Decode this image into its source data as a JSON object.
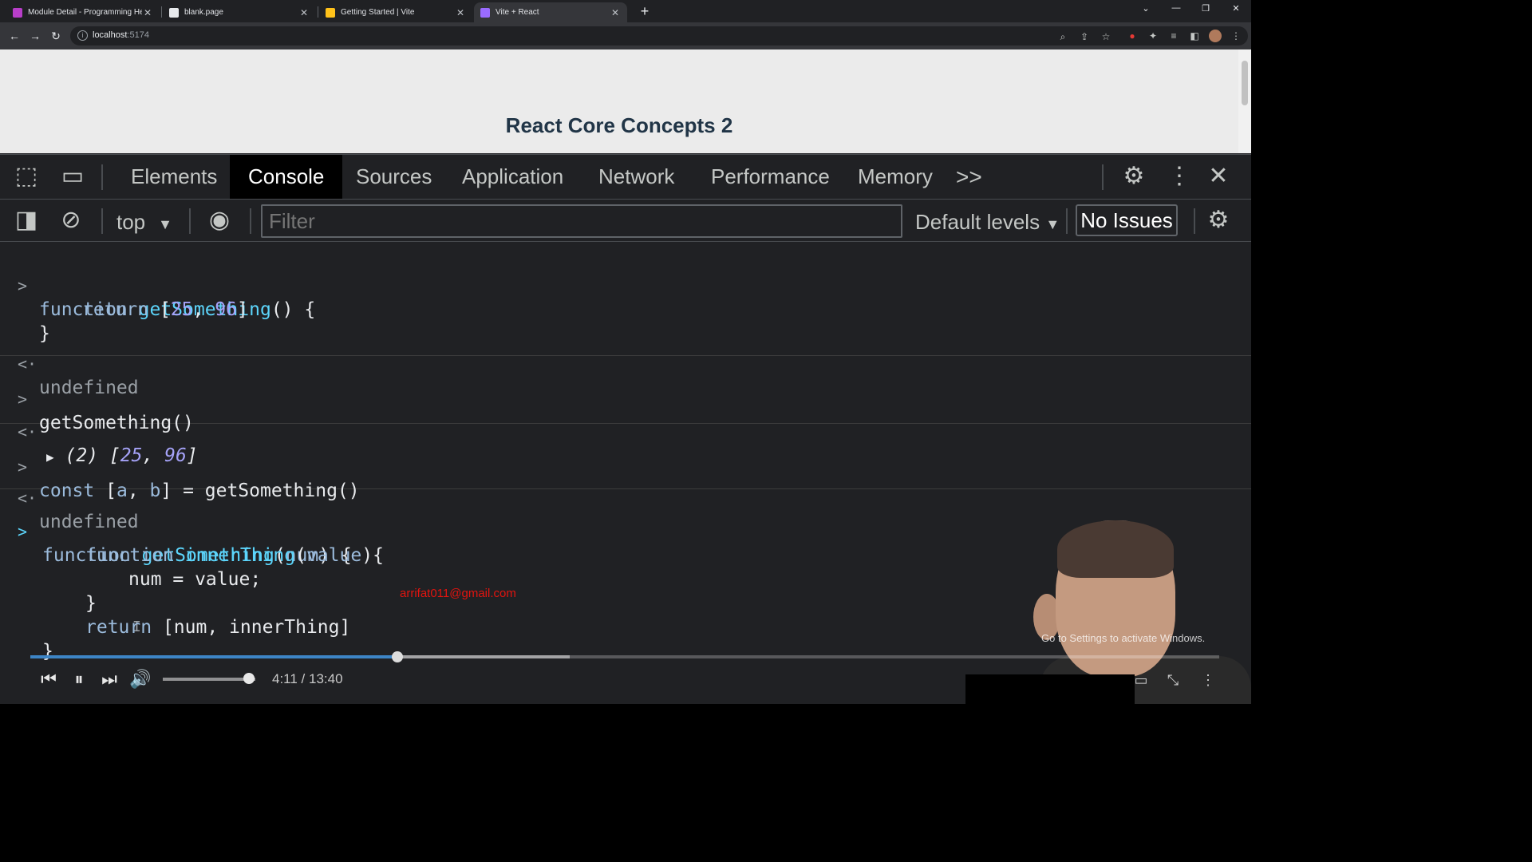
{
  "tabs": [
    {
      "title": "Module Detail - Programming Hero",
      "favicon_color": "#b83ec9"
    },
    {
      "title": "blank.page",
      "favicon_color": "#e8eaed"
    },
    {
      "title": "Getting Started | Vite",
      "favicon_color": "#ffc21a"
    },
    {
      "title": "Vite + React",
      "favicon_color": "#9a6bff",
      "active": true
    }
  ],
  "omnibox": {
    "host": "localhost",
    "port": ":5174"
  },
  "page": {
    "heading": "React Core Concepts 2"
  },
  "devtools": {
    "tabs": [
      "Elements",
      "Console",
      "Sources",
      "Application",
      "Network",
      "Performance",
      "Memory"
    ],
    "active_tab": "Console",
    "more": ">>",
    "console_bar": {
      "context": "top",
      "filter_placeholder": "Filter",
      "levels": "Default levels",
      "issues": "No Issues"
    }
  },
  "console": {
    "e1": {
      "l1a": "function",
      "l1b": "getSomething",
      "l1c": "() {",
      "l2a": "return",
      "l2b": " [",
      "l2c": "25",
      "l2d": ", ",
      "l2e": "96",
      "l2f": "]",
      "l3": "}",
      "result": "undefined"
    },
    "e2": {
      "cmd": "getSomething()",
      "r_count": "(2) [",
      "r_a": "25",
      "r_sep": ", ",
      "r_b": "96",
      "r_end": "]"
    },
    "e3": {
      "l_kw": "const",
      "l_rest1": " [",
      "l_a": "a",
      "l_sep": ", ",
      "l_b": "b",
      "l_rest2": "] = getSomething()",
      "result": "undefined"
    },
    "e4": {
      "l1a": "function",
      "l1b": "getSomething",
      "l1c": "(",
      "l1d": "num",
      "l1e": ") {",
      "l2a": "function",
      "l2b": "innerThing",
      "l2c": "(",
      "l2d": "value",
      "l2e": "){",
      "l3": "num = value;",
      "l4": "}",
      "l5a": "return",
      "l5b": " [num, innerThing]",
      "l6": "}"
    }
  },
  "overlay": {
    "email": "arrifat011@gmail.com",
    "watermark": "Go to Settings to activate Windows."
  },
  "player": {
    "time": "4:11 / 13:40",
    "progress": 0.309,
    "buffered": 0.454,
    "volume": 0.93
  }
}
